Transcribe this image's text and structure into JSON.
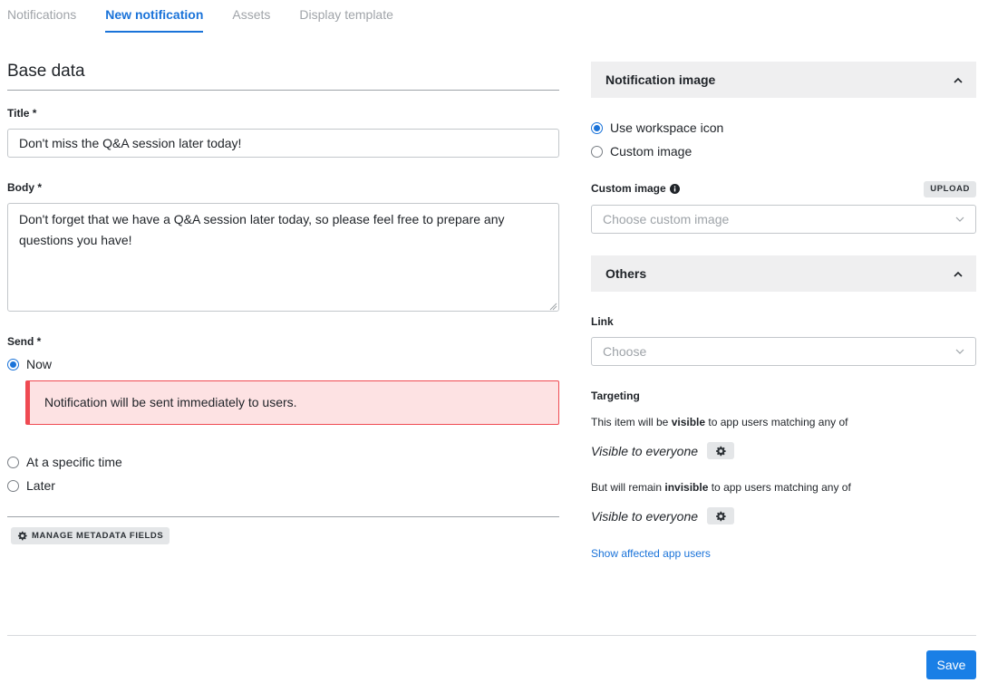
{
  "tabs": [
    "Notifications",
    "New notification",
    "Assets",
    "Display template"
  ],
  "base": {
    "section_title": "Base data",
    "title_label": "Title *",
    "title_value": "Don't miss the Q&A session later today!",
    "body_label": "Body *",
    "body_value": "Don't forget that we have a Q&A session later today, so please feel free to prepare any questions you have!",
    "send_label": "Send *",
    "send_options": [
      "Now",
      "At a specific time",
      "Later"
    ],
    "send_selected": "Now",
    "alert_text": "Notification will be sent immediately to users.",
    "manage_metadata": "MANAGE METADATA FIELDS"
  },
  "image_panel": {
    "title": "Notification image",
    "options": [
      "Use workspace icon",
      "Custom image"
    ],
    "selected": "Use workspace icon",
    "custom_label": "Custom image",
    "upload_label": "UPLOAD",
    "select_placeholder": "Choose custom image"
  },
  "others_panel": {
    "title": "Others",
    "link_label": "Link",
    "link_placeholder": "Choose",
    "targeting_label": "Targeting",
    "visible_prefix": "This item will be ",
    "visible_bold": "visible",
    "visible_suffix": " to app users matching any of",
    "visible_value": "Visible to everyone",
    "invisible_prefix": "But will remain ",
    "invisible_bold": "invisible",
    "invisible_suffix": " to app users matching any of",
    "invisible_value": "Visible to everyone",
    "show_users_link": "Show affected app users"
  },
  "footer": {
    "save_label": "Save"
  },
  "colors": {
    "accent": "#1a73d9",
    "alert_bg": "#fde2e3",
    "alert_border": "#ef4a52",
    "save_bg": "#1a7fe6"
  }
}
